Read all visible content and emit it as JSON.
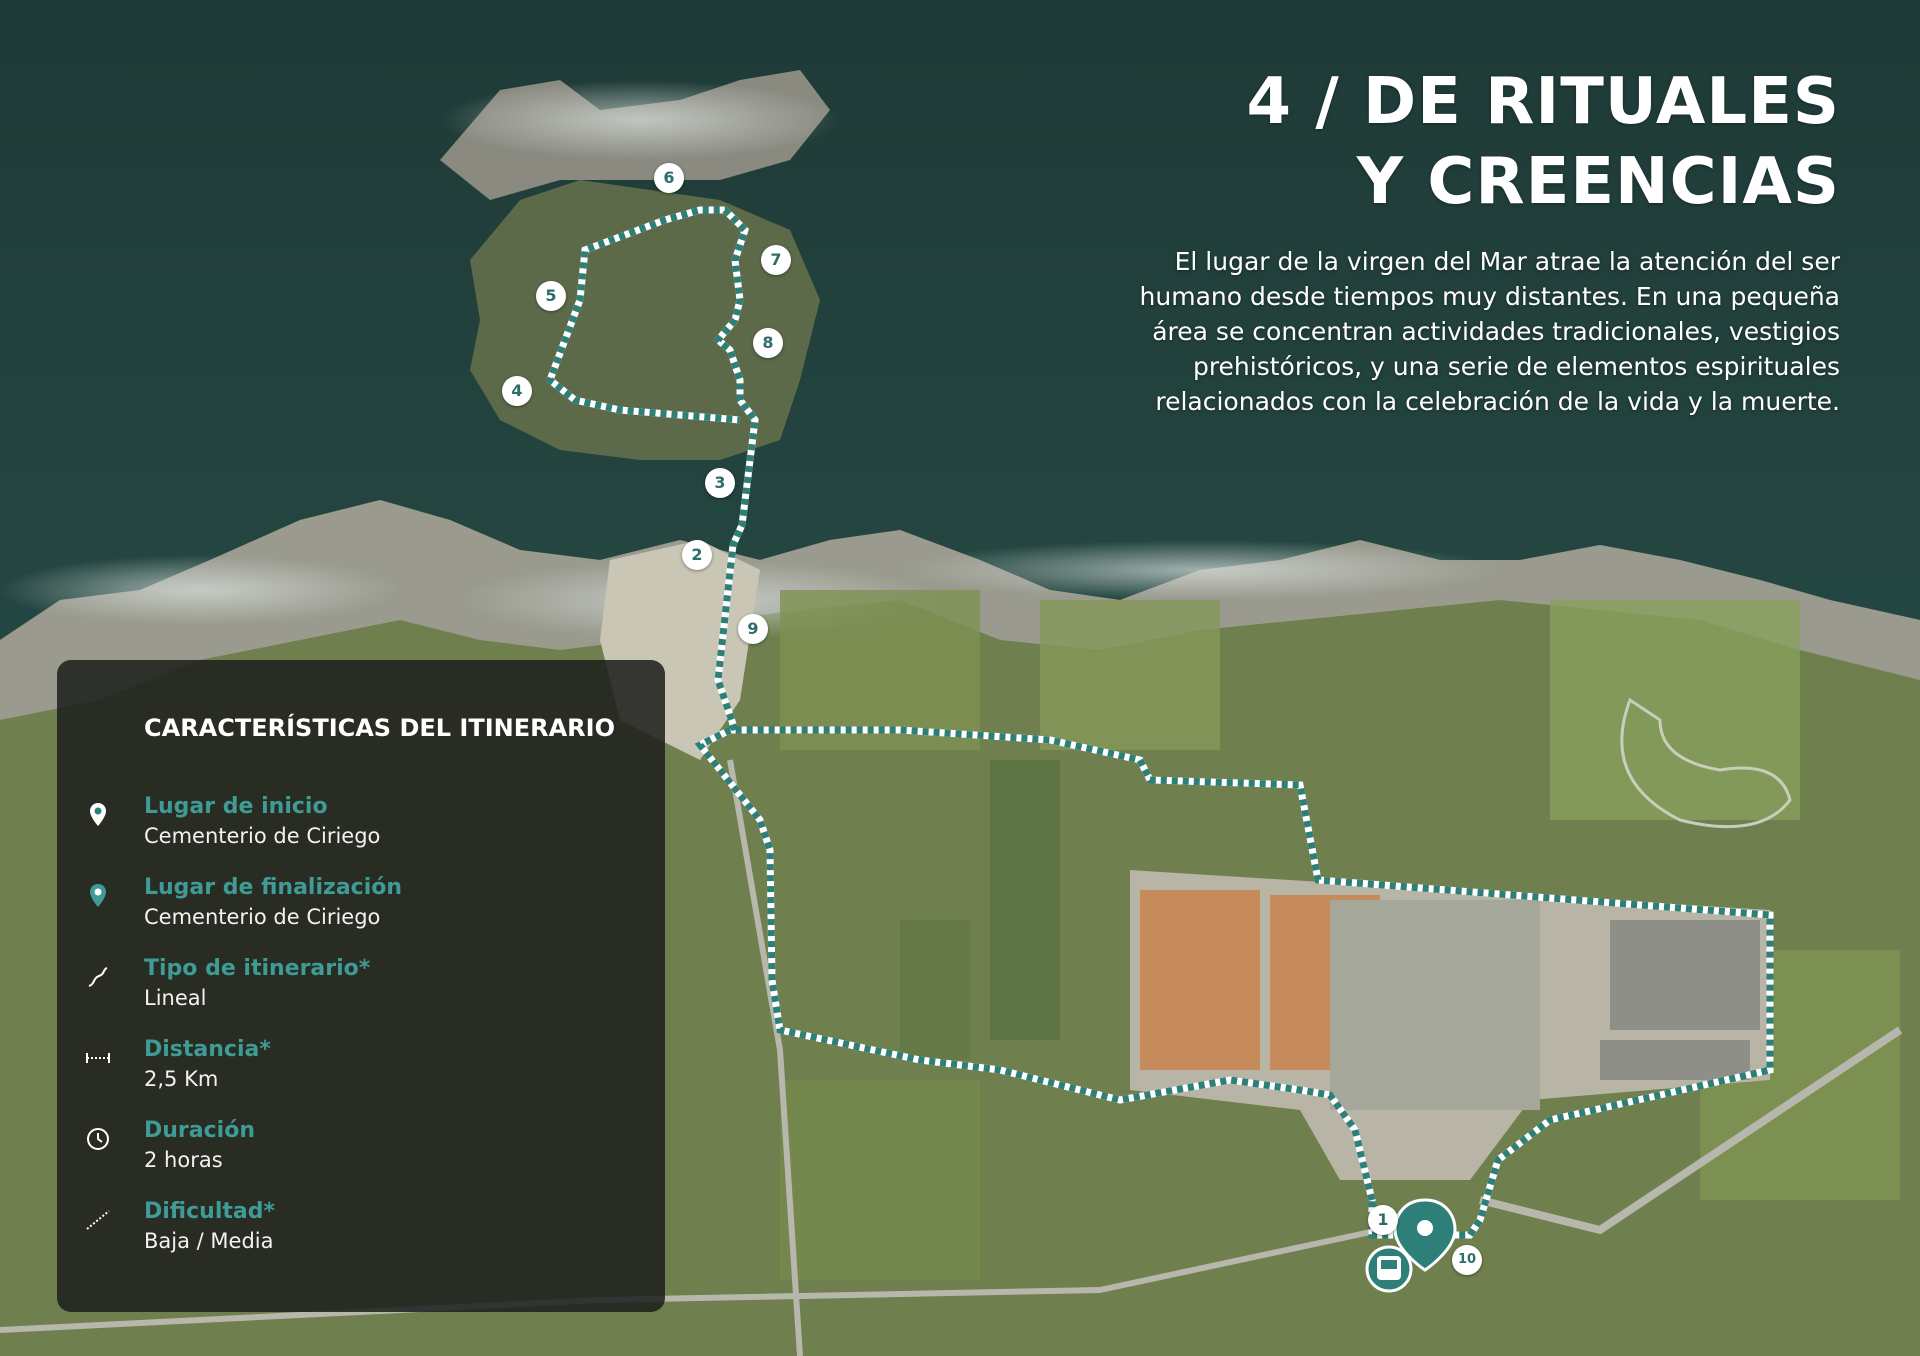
{
  "title": {
    "line1": "4 / DE RITUALES",
    "line2": "Y CREENCIAS"
  },
  "description": "El lugar de la virgen del Mar atrae la atención del ser humano desde tiempos muy distantes. En una pequeña área se concentran actividades tradicionales, vestigios prehistóricos, y una serie de elementos espirituales relacionados con la celebración de la vida y la muerte.",
  "colors": {
    "route": "#2f7f79",
    "accent": "#3e9b95",
    "panel": "#1c1e1c",
    "sea": "#23433f",
    "land": "#6b7d4c"
  },
  "panel": {
    "title": "CARACTERÍSTICAS DEL ITINERARIO",
    "features": [
      {
        "icon": "location-pin-icon",
        "label": "Lugar de inicio",
        "value": "Cementerio de Ciriego"
      },
      {
        "icon": "location-pin-outline-icon",
        "label": "Lugar de finalización",
        "value": "Cementerio de Ciriego"
      },
      {
        "icon": "route-type-icon",
        "label": "Tipo de itinerario*",
        "value": "Lineal"
      },
      {
        "icon": "distance-ruler-icon",
        "label": "Distancia*",
        "value": "2,5 Km"
      },
      {
        "icon": "clock-icon",
        "label": "Duración",
        "value": "2 horas"
      },
      {
        "icon": "difficulty-slope-icon",
        "label": "Dificultad*",
        "value": "Baja / Media"
      }
    ]
  },
  "stops": [
    "1",
    "2",
    "3",
    "4",
    "5",
    "6",
    "7",
    "8",
    "9",
    "10"
  ],
  "map_icons": {
    "start_marker": "location-pin-icon",
    "bus_stop": "bus-icon"
  }
}
